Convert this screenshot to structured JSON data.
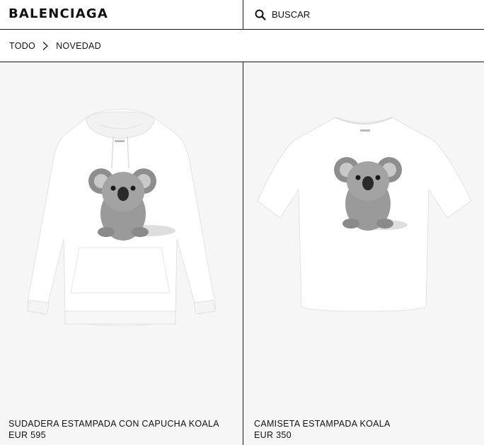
{
  "header": {
    "logo": "BALENCIAGA",
    "search": {
      "placeholder": "BUSCAR",
      "value": ""
    }
  },
  "breadcrumb": {
    "items": [
      "TODO",
      "NOVEDAD"
    ]
  },
  "products": [
    {
      "name": "SUDADERA ESTAMPADA CON CAPUCHA KOALA",
      "price": "EUR 595"
    },
    {
      "name": "CAMISETA ESTAMPADA KOALA",
      "price": "EUR 350"
    }
  ],
  "colors": {
    "text": "#111111",
    "border": "#1a1a1a",
    "card_bg": "#f6f6f6"
  }
}
